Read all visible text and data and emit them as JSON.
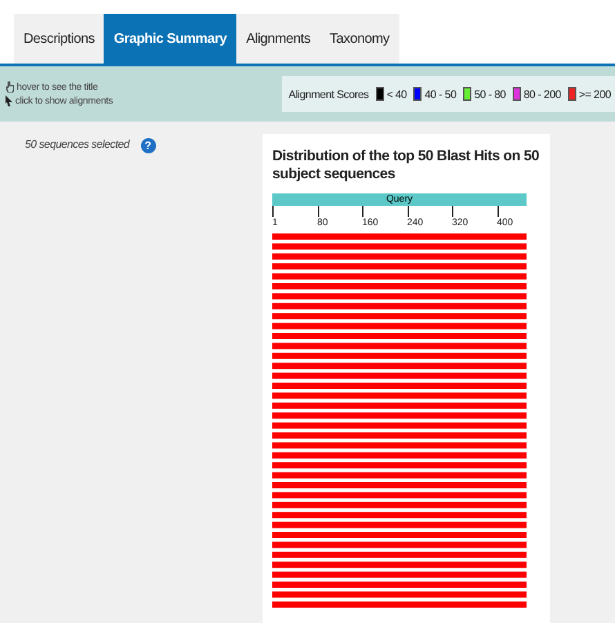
{
  "tabs": [
    {
      "label": "Descriptions",
      "selected": false
    },
    {
      "label": "Graphic Summary",
      "selected": true
    },
    {
      "label": "Alignments",
      "selected": false
    },
    {
      "label": "Taxonomy",
      "selected": false
    }
  ],
  "toolbar": {
    "hints": [
      {
        "kind": "hover",
        "text": "hover to see the title"
      },
      {
        "kind": "click",
        "text": "click to show alignments"
      }
    ],
    "legend": {
      "label": "Alignment Scores",
      "items": [
        {
          "label": "< 40",
          "color": "#000000"
        },
        {
          "label": "40 - 50",
          "color": "#0000ff"
        },
        {
          "label": "50 - 80",
          "color": "#66ee33"
        },
        {
          "label": "80 - 200",
          "color": "#dd33dd"
        },
        {
          "label": ">= 200",
          "color": "#ee2222"
        }
      ]
    }
  },
  "selection": {
    "text": "50 sequences selected",
    "help": "?"
  },
  "graphic": {
    "title": "Distribution of the top 50 Blast Hits on 50 subject sequences",
    "query_label": "Query",
    "ticks": [
      "1",
      "80",
      "160",
      "240",
      "320",
      "400"
    ]
  }
}
